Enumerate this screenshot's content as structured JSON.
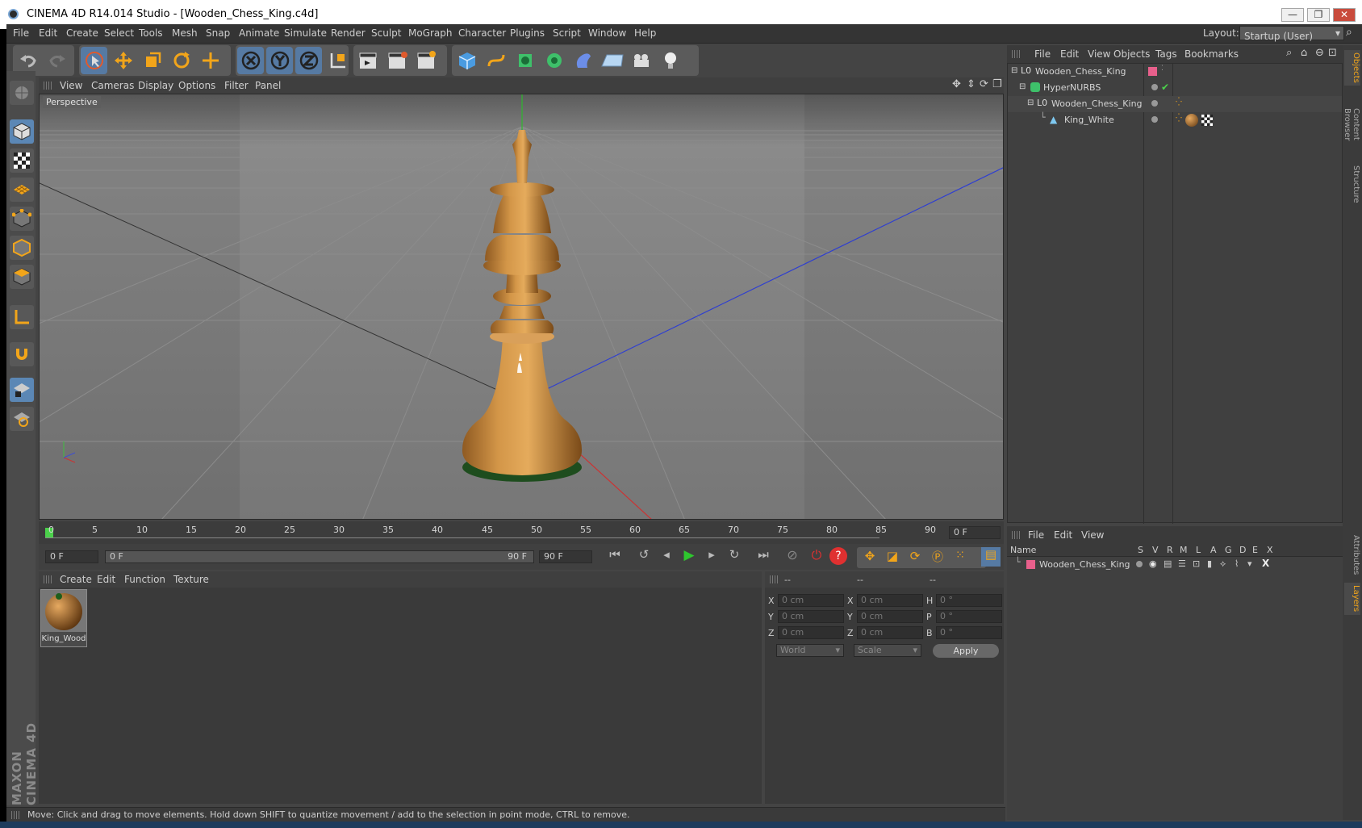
{
  "window": {
    "title": "CINEMA 4D R14.014 Studio - [Wooden_Chess_King.c4d]",
    "min": "—",
    "max": "❐",
    "close": "✕"
  },
  "menu": [
    "File",
    "Edit",
    "Create",
    "Select",
    "Tools",
    "Mesh",
    "Snap",
    "Animate",
    "Simulate",
    "Render",
    "Sculpt",
    "MoGraph",
    "Character",
    "Plugins",
    "Script",
    "Window",
    "Help"
  ],
  "layout": {
    "label": "Layout:",
    "value": "Startup (User)"
  },
  "viewport": {
    "menu": [
      "View",
      "Cameras",
      "Display",
      "Options",
      "Filter",
      "Panel"
    ],
    "label": "Perspective"
  },
  "timeline": {
    "ticks": [
      "0",
      "5",
      "10",
      "15",
      "20",
      "25",
      "30",
      "35",
      "40",
      "45",
      "50",
      "55",
      "60",
      "65",
      "70",
      "75",
      "80",
      "85",
      "90"
    ],
    "end_field": "0 F"
  },
  "transport": {
    "start": "0 F",
    "range_start": "0 F",
    "range_end": "90 F",
    "end": "90 F"
  },
  "materials": {
    "menu": [
      "Create",
      "Edit",
      "Function",
      "Texture"
    ],
    "items": [
      {
        "name": "King_Wood"
      }
    ]
  },
  "coords": {
    "heads": [
      "--",
      "--",
      "--"
    ],
    "rows": [
      {
        "a": "X",
        "v1": "0 cm",
        "b": "X",
        "v2": "0 cm",
        "c": "H",
        "v3": "0 °"
      },
      {
        "a": "Y",
        "v1": "0 cm",
        "b": "Y",
        "v2": "0 cm",
        "c": "P",
        "v3": "0 °"
      },
      {
        "a": "Z",
        "v1": "0 cm",
        "b": "Z",
        "v2": "0 cm",
        "c": "B",
        "v3": "0 °"
      }
    ],
    "world": "World",
    "scale": "Scale",
    "apply": "Apply"
  },
  "status": "Move: Click and drag to move elements. Hold down SHIFT to quantize movement / add to the selection in point mode, CTRL to remove.",
  "objects": {
    "menu": [
      "File",
      "Edit",
      "View",
      "Objects",
      "Tags",
      "Bookmarks"
    ],
    "tree": [
      {
        "name": "Wooden_Chess_King",
        "level": 0
      },
      {
        "name": "HyperNURBS",
        "level": 1
      },
      {
        "name": "Wooden_Chess_King",
        "level": 2
      },
      {
        "name": "King_White",
        "level": 3
      }
    ]
  },
  "layers": {
    "menu": [
      "File",
      "Edit",
      "View"
    ],
    "cols": [
      "Name",
      "S",
      "V",
      "R",
      "M",
      "L",
      "A",
      "G",
      "D",
      "E",
      "X"
    ],
    "rows": [
      {
        "name": "Wooden_Chess_King"
      }
    ]
  },
  "side_tabs": [
    "Objects",
    "Content Browser",
    "Structure",
    "Attributes",
    "Layers"
  ],
  "brand": "MAXON CINEMA 4D",
  "colors": {
    "accent": "#5b87b5",
    "wood": "#c98a3e",
    "layer_pink": "#e8608c"
  }
}
